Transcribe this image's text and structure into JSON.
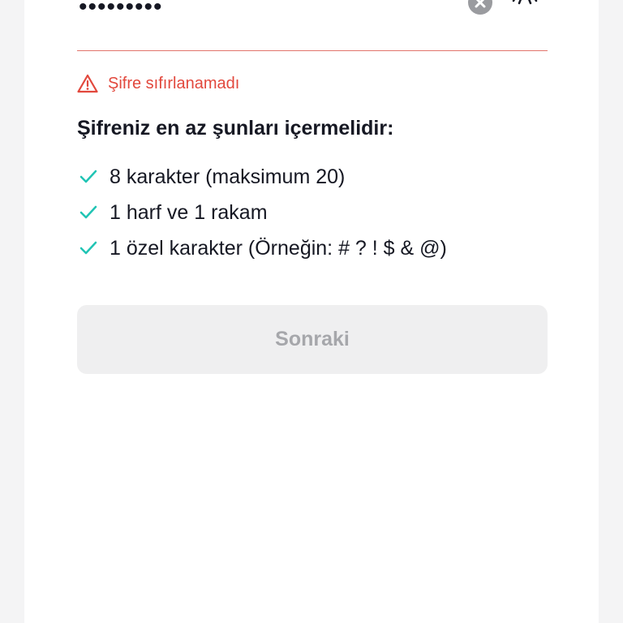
{
  "password": {
    "masked_value": "•••••••••",
    "clear_icon": "clear-circle-icon",
    "visibility_icon": "eye-closed-icon"
  },
  "error": {
    "icon": "warning-icon",
    "message": "Şifre sıfırlanamadı",
    "color": "#e2483d"
  },
  "requirements": {
    "title": "Şifreniz en az şunları içermelidir:",
    "check_color": "#20c4b4",
    "items": [
      {
        "label": "8 karakter (maksimum 20)"
      },
      {
        "label": "1 harf ve 1 rakam"
      },
      {
        "label": "1 özel karakter (Örneğin: # ? ! $ & @)"
      }
    ]
  },
  "next_button": {
    "label": "Sonraki",
    "disabled": true
  }
}
